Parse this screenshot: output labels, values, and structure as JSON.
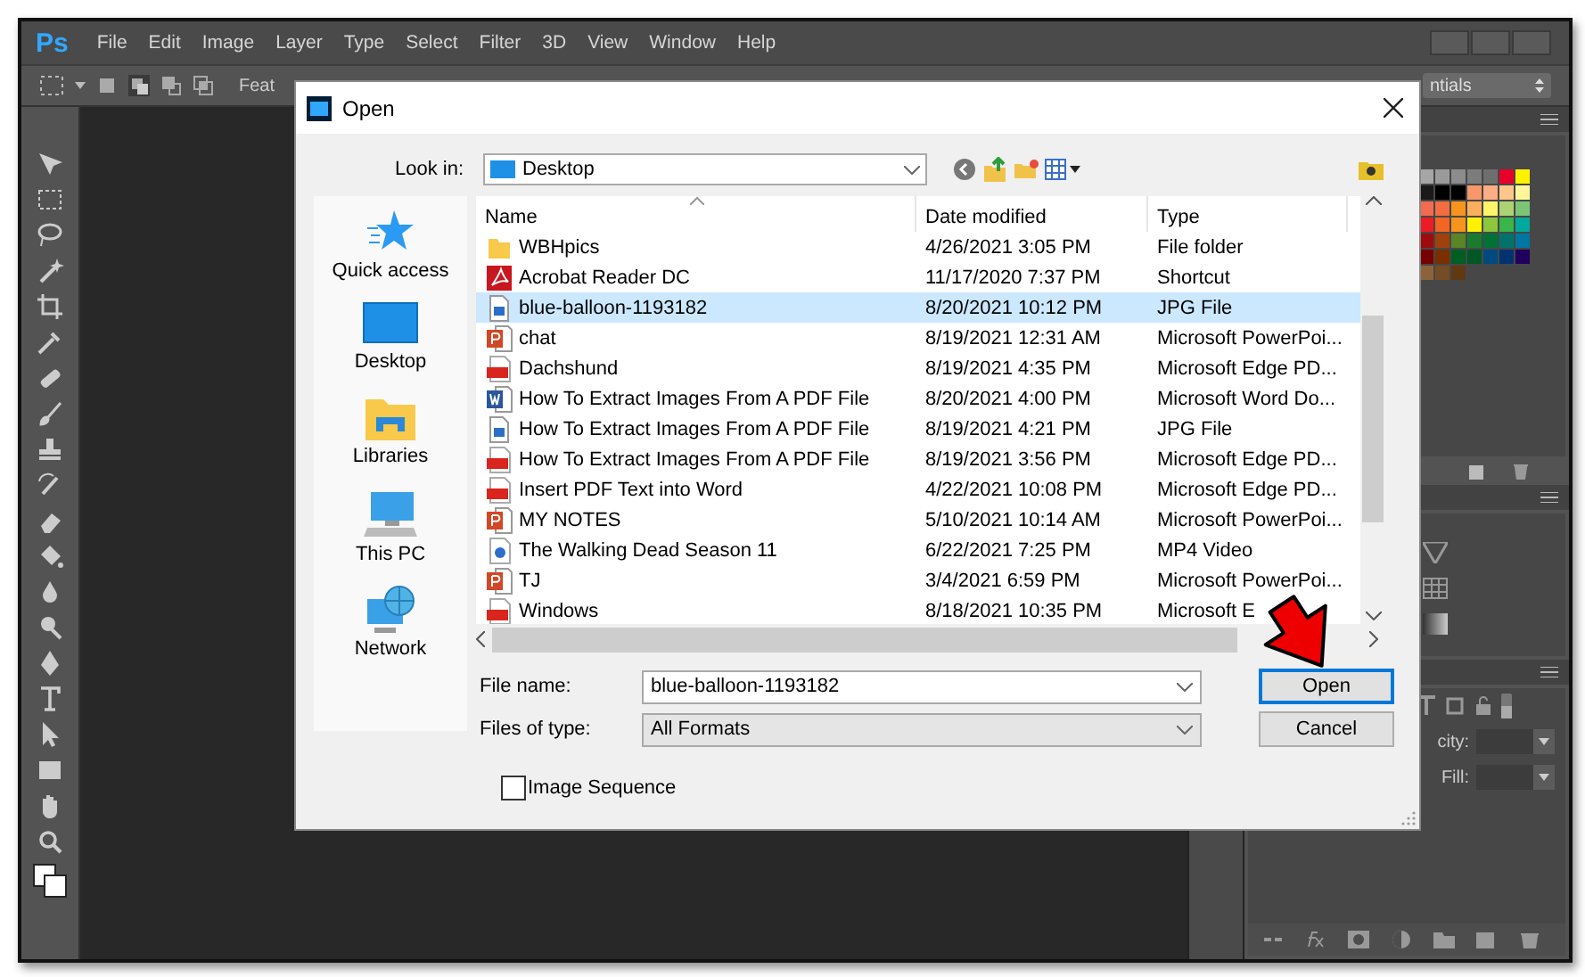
{
  "app": {
    "logo": "Ps",
    "menu": [
      "File",
      "Edit",
      "Image",
      "Layer",
      "Type",
      "Select",
      "Filter",
      "3D",
      "View",
      "Window",
      "Help"
    ],
    "options_bar": {
      "feature_label": "Feat",
      "workspace": "ntials"
    },
    "layers_panel": {
      "opacity_label": "city:",
      "fill_label": "Fill:"
    }
  },
  "dialog": {
    "title": "Open",
    "look_in_label": "Look in:",
    "look_in": "Desktop",
    "places": [
      {
        "label": "Quick access",
        "kind": "star"
      },
      {
        "label": "Desktop",
        "kind": "desktop"
      },
      {
        "label": "Libraries",
        "kind": "libraries"
      },
      {
        "label": "This PC",
        "kind": "pc"
      },
      {
        "label": "Network",
        "kind": "network"
      }
    ],
    "columns": [
      "Name",
      "Date modified",
      "Type"
    ],
    "files": [
      {
        "name": "WBHpics",
        "date": "4/26/2021 3:05 PM",
        "type": "File folder",
        "kind": "folder",
        "selected": false
      },
      {
        "name": "Acrobat Reader DC",
        "date": "11/17/2020 7:37 PM",
        "type": "Shortcut",
        "kind": "acrobat",
        "selected": false
      },
      {
        "name": "blue-balloon-1193182",
        "date": "8/20/2021 10:12 PM",
        "type": "JPG File",
        "kind": "image",
        "selected": true
      },
      {
        "name": "chat",
        "date": "8/19/2021 12:31 AM",
        "type": "Microsoft PowerPoi...",
        "kind": "slides",
        "selected": false
      },
      {
        "name": "Dachshund",
        "date": "8/19/2021 4:35 PM",
        "type": "Microsoft Edge PD...",
        "kind": "pdf",
        "selected": false
      },
      {
        "name": "How To Extract Images From A PDF File",
        "date": "8/20/2021 4:00 PM",
        "type": "Microsoft Word Do...",
        "kind": "word",
        "selected": false
      },
      {
        "name": "How To Extract Images From A PDF File",
        "date": "8/19/2021 4:21 PM",
        "type": "JPG File",
        "kind": "image",
        "selected": false
      },
      {
        "name": "How To Extract Images From A PDF File",
        "date": "8/19/2021 3:56 PM",
        "type": "Microsoft Edge PD...",
        "kind": "pdf",
        "selected": false
      },
      {
        "name": "Insert PDF Text into Word",
        "date": "4/22/2021 10:08 PM",
        "type": "Microsoft Edge PD...",
        "kind": "pdf",
        "selected": false
      },
      {
        "name": "MY NOTES",
        "date": "5/10/2021 10:14 AM",
        "type": "Microsoft PowerPoi...",
        "kind": "slides",
        "selected": false
      },
      {
        "name": "The Walking Dead Season 11",
        "date": "6/22/2021 7:25 PM",
        "type": "MP4 Video",
        "kind": "video",
        "selected": false
      },
      {
        "name": "TJ",
        "date": "3/4/2021 6:59 PM",
        "type": "Microsoft PowerPoi...",
        "kind": "slides",
        "selected": false
      },
      {
        "name": "Windows",
        "date": "8/18/2021 10:35 PM",
        "type": "Microsoft E",
        "kind": "pdf",
        "selected": false
      }
    ],
    "file_name_label": "File name:",
    "file_name": "blue-balloon-1193182",
    "file_type_label": "Files of type:",
    "file_type": "All Formats",
    "buttons": [
      {
        "label": "Open",
        "kind": "default"
      },
      {
        "label": "Cancel",
        "kind": "normal"
      }
    ],
    "image_sequence": {
      "label": "Image Sequence",
      "checked": false
    }
  }
}
